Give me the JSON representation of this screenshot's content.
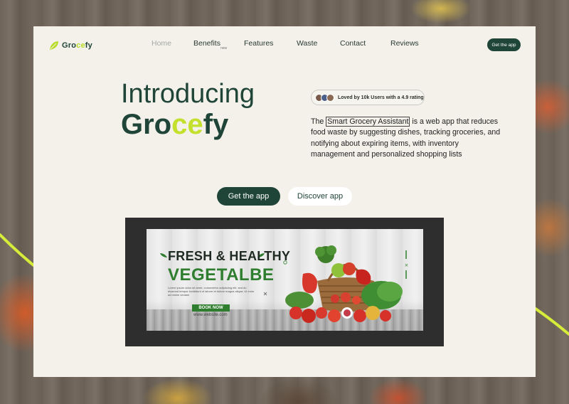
{
  "brand": {
    "name_part1": "Gro",
    "name_highlight": "ce",
    "name_part2": "fy"
  },
  "nav": {
    "items": [
      "Home",
      "Benefits",
      "Features",
      "Waste",
      "Contact",
      "Reviews"
    ],
    "active": "Home",
    "benefits_badge": "new",
    "cta_label": "Get the app"
  },
  "hero": {
    "title_line1": "Introducing",
    "title_part1": "Gro",
    "title_highlight": "ce",
    "title_part2": "fy",
    "rating_text": "Loved by 10k Users with a 4.9 rating",
    "desc_before": "The ",
    "desc_boxed": "Smart Grocery Assistant",
    "desc_after": " is a web app that reduces food waste by suggesting dishes, tracking groceries, and notifying about expiring items, with inventory management and personalized shopping lists",
    "primary_btn": "Get the app",
    "secondary_btn": "Discover app"
  },
  "banner": {
    "headline1": "FRESH & HEALTHY",
    "headline2": "VEGETALBE",
    "body": "Lorem ipsum dolor sit amet, consectetur adipiscing elit, sed do eiusmod tempor incididunt ut labore et dolore magna aliqua. Ut enim ad minim veniam",
    "cta": "BOOK NOW",
    "website": "www.website.com"
  },
  "colors": {
    "brand_dark": "#1f4438",
    "brand_accent": "#c3e02c",
    "card_bg": "#f3f1ea",
    "banner_green": "#2f7d2e"
  }
}
